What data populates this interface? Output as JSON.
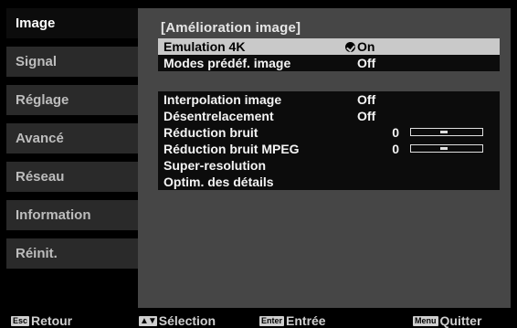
{
  "sidebar": {
    "items": [
      {
        "label": "Image"
      },
      {
        "label": "Signal"
      },
      {
        "label": "Réglage"
      },
      {
        "label": "Avancé"
      },
      {
        "label": "Réseau"
      },
      {
        "label": "Information"
      },
      {
        "label": "Réinit."
      }
    ]
  },
  "panel": {
    "title": "[Amélioration image]",
    "group1": [
      {
        "label": "Emulation 4K",
        "value": "On"
      },
      {
        "label": "Modes prédéf. image",
        "value": "Off"
      }
    ],
    "group2": [
      {
        "label": "Interpolation image",
        "value": "Off"
      },
      {
        "label": "Désentrelacement",
        "value": "Off"
      },
      {
        "label": "Réduction bruit",
        "value": "0",
        "level": 0.45
      },
      {
        "label": "Réduction bruit MPEG",
        "value": "0",
        "level": 0.45
      },
      {
        "label": "Super-resolution"
      },
      {
        "label": "Optim. des détails"
      }
    ]
  },
  "footer": {
    "back": {
      "key": "Esc",
      "label": "Retour"
    },
    "select": {
      "key": "▲▼",
      "label": "Sélection"
    },
    "enter": {
      "key": "Enter",
      "label": "Entrée"
    },
    "quit": {
      "key": "Menu",
      "label": "Quitter"
    }
  },
  "colors": {
    "panel_bg": "#464646",
    "row_bg": "#0c0c0c",
    "selected_bg": "#c9c9c9",
    "sidebar_item_bg": "#2a2a2a"
  }
}
